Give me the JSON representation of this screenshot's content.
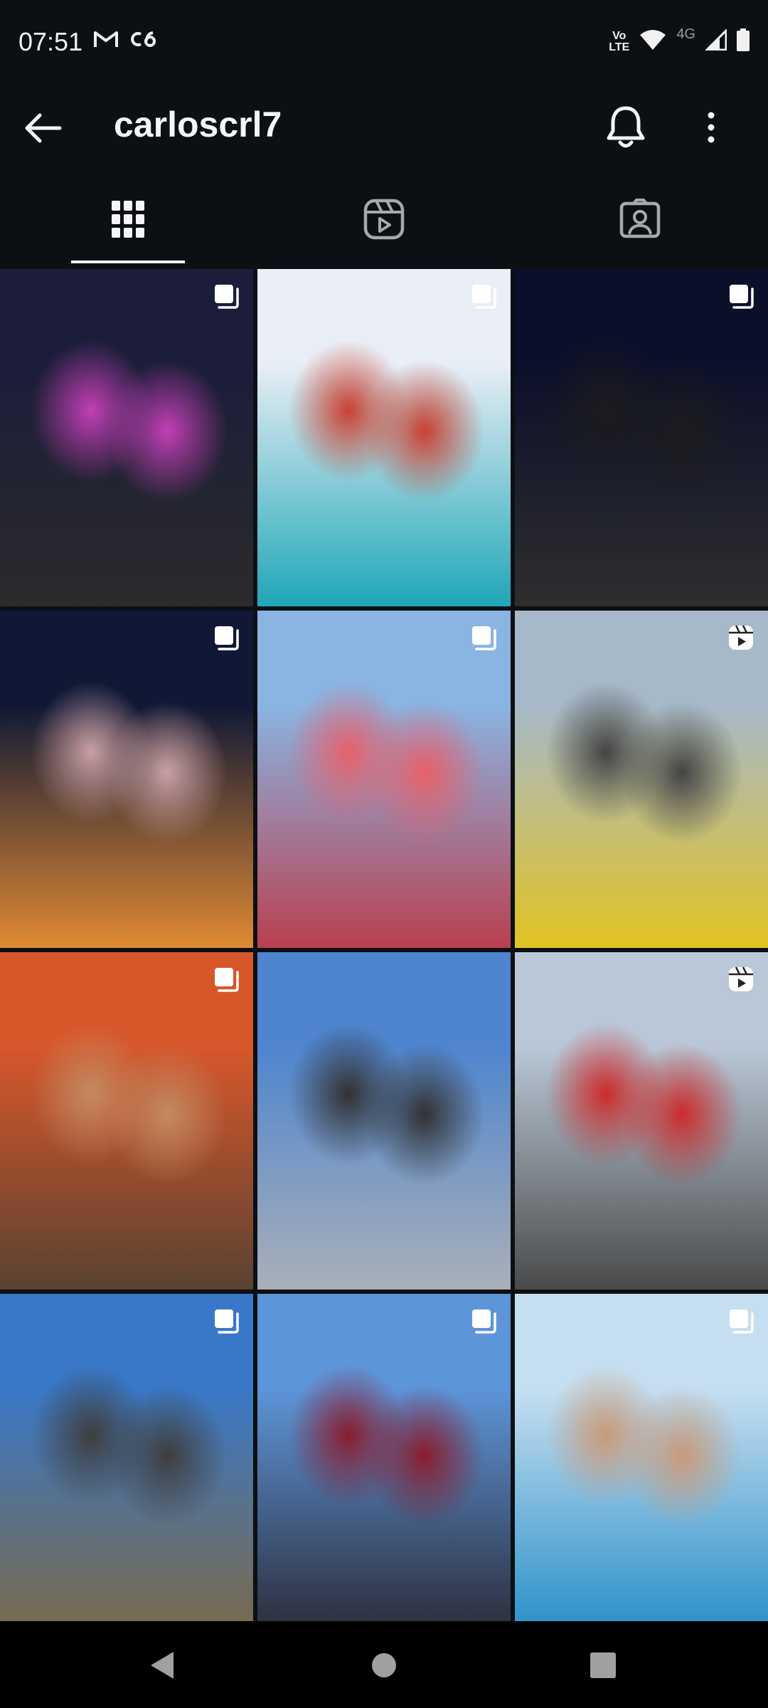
{
  "status_bar": {
    "time": "07:51",
    "left_icons": [
      "gmail-icon",
      "c6-icon"
    ],
    "volte_line1": "Vo",
    "volte_line2": "LTE",
    "network_label": "4G",
    "right_icons": [
      "wifi-icon",
      "signal-icon",
      "battery-icon"
    ]
  },
  "app_bar": {
    "title": "carloscrl7",
    "icons": [
      "back-arrow-icon",
      "bell-icon",
      "more-vertical-icon"
    ]
  },
  "tabs": [
    {
      "name": "grid",
      "icon": "grid-icon",
      "selected": true
    },
    {
      "name": "reels",
      "icon": "reels-icon",
      "selected": false
    },
    {
      "name": "tagged",
      "icon": "tagged-icon",
      "selected": false
    }
  ],
  "posts": [
    {
      "badge": "carousel-icon",
      "colors": [
        "#1b1d3a",
        "#c23fb5",
        "#2b2b2b"
      ]
    },
    {
      "badge": "carousel-icon",
      "colors": [
        "#e9eef5",
        "#c84131",
        "#1fa7b8"
      ]
    },
    {
      "badge": "carousel-icon",
      "colors": [
        "#0c0f2a",
        "#1c1c1c",
        "#2e2e2e"
      ]
    },
    {
      "badge": "carousel-icon",
      "colors": [
        "#101835",
        "#c9a0a5",
        "#e08a33"
      ]
    },
    {
      "badge": "carousel-icon",
      "colors": [
        "#8ab4e2",
        "#e8606a",
        "#b94050"
      ]
    },
    {
      "badge": "reels-icon",
      "colors": [
        "#a7b9c9",
        "#444444",
        "#e2c322"
      ]
    },
    {
      "badge": "carousel-icon",
      "colors": [
        "#d7572b",
        "#c58a61",
        "#5a4232"
      ]
    },
    {
      "badge": "",
      "colors": [
        "#4f85cf",
        "#323232",
        "#aab0b8"
      ]
    },
    {
      "badge": "reels-icon",
      "colors": [
        "#b9c7d6",
        "#cc2b2b",
        "#4a4a4a"
      ]
    },
    {
      "badge": "carousel-icon",
      "colors": [
        "#3978c7",
        "#3e3e3e",
        "#7b6a4d"
      ]
    },
    {
      "badge": "carousel-icon",
      "colors": [
        "#5d95d9",
        "#8a1d2e",
        "#2c2d3a"
      ]
    },
    {
      "badge": "carousel-icon",
      "colors": [
        "#c6dff0",
        "#c99a7a",
        "#2a8fc9"
      ]
    }
  ],
  "nav_bar": {
    "buttons": [
      "back-triangle-icon",
      "home-circle-icon",
      "recents-square-icon"
    ]
  },
  "colors": {
    "background": "#0c1014",
    "foreground": "#f5f5f5",
    "nav_background": "#000000"
  }
}
